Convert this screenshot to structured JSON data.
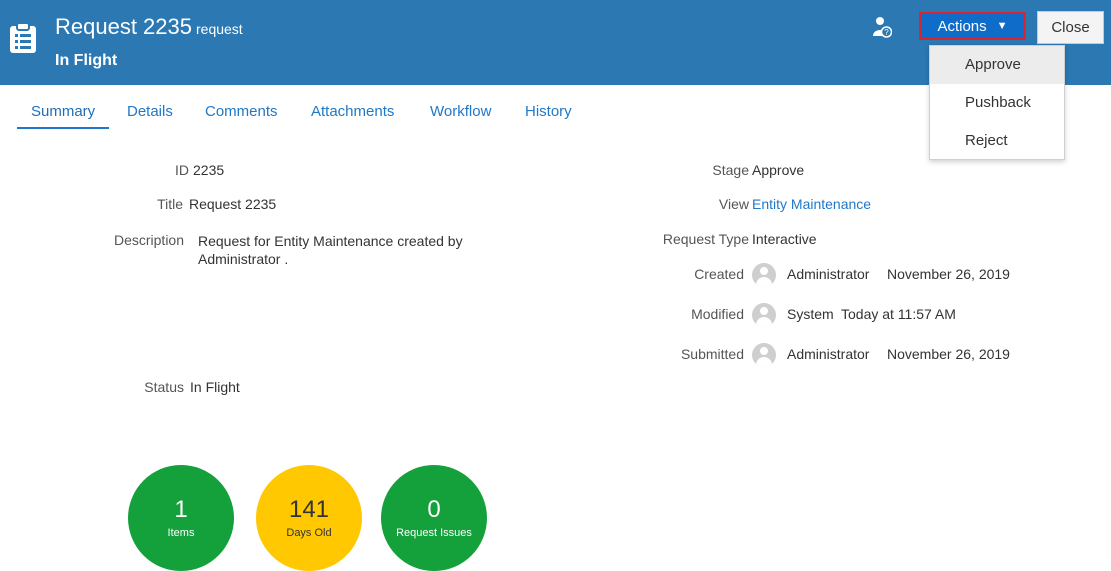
{
  "header": {
    "title": "Request 2235",
    "type": "request",
    "status": "In Flight",
    "bg_color": "#2b78b3",
    "icon": "clipboard-list-icon",
    "user_icon": "user-question-icon"
  },
  "actions": {
    "label": "Actions",
    "caret": "▼",
    "bg_color": "#0f6cc9",
    "close_label": "Close",
    "menu": [
      "Approve",
      "Pushback",
      "Reject"
    ]
  },
  "tabs": [
    "Summary",
    "Details",
    "Comments",
    "Attachments",
    "Workflow",
    "History"
  ],
  "left": {
    "id_label": "ID",
    "id_value": "2235",
    "title_label": "Title",
    "title_value": "Request 2235",
    "description_label": "Description",
    "description_value": "Request for Entity Maintenance created by Administrator .",
    "status_label": "Status",
    "status_value": "In Flight"
  },
  "right": {
    "stage_label": "Stage",
    "stage_value": "Approve",
    "view_label": "View",
    "view_value": "Entity Maintenance",
    "request_type_label": "Request Type",
    "request_type_value": "Interactive",
    "created_label": "Created",
    "created_user": "Administrator",
    "created_date": "November 26, 2019",
    "modified_label": "Modified",
    "modified_user": "System",
    "modified_date": "Today at 11:57 AM",
    "submitted_label": "Submitted",
    "submitted_user": "Administrator",
    "submitted_date": "November 26, 2019"
  },
  "metrics": [
    {
      "value": "1",
      "label": "Items",
      "color": "#14a03a"
    },
    {
      "value": "141",
      "label": "Days Old",
      "color": "#ffc800"
    },
    {
      "value": "0",
      "label": "Request Issues",
      "color": "#14a03a"
    }
  ]
}
